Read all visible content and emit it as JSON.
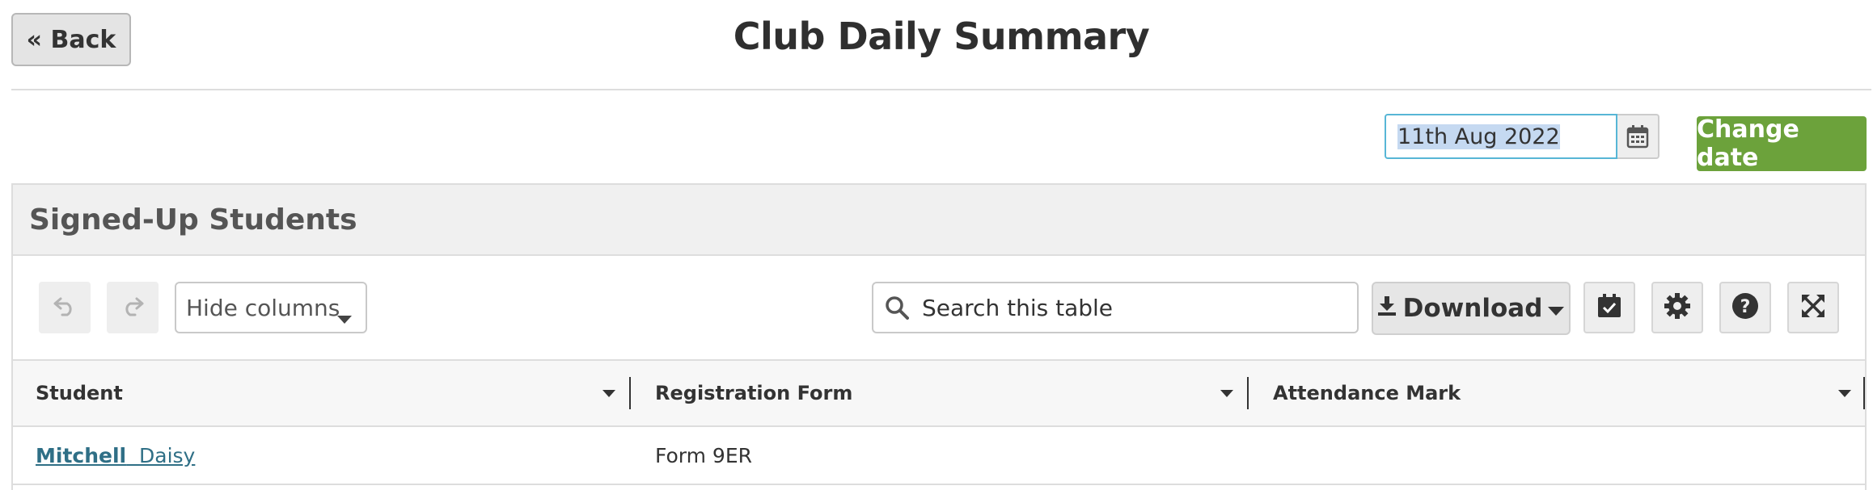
{
  "header": {
    "back_label": "« Back",
    "title": "Club Daily Summary"
  },
  "date_picker": {
    "value": "11th Aug 2022",
    "calendar_icon": "calendar-icon",
    "change_label": "Change date",
    "change_color": "#6ca23b"
  },
  "panel": {
    "title": "Signed-Up Students"
  },
  "toolbar": {
    "undo_icon": "undo-icon",
    "redo_icon": "redo-icon",
    "hide_columns_label": "Hide columns",
    "search_placeholder": "Search this table",
    "download_label": "Download",
    "select_icon": "calendar-check-icon",
    "settings_icon": "gear-icon",
    "help_icon": "question-circle-icon",
    "fullscreen_icon": "expand-icon"
  },
  "table": {
    "columns": [
      "Student",
      "Registration Form",
      "Attendance Mark"
    ],
    "rows": [
      {
        "surname": "Mitchell",
        "forename": "Daisy",
        "registration_form": "Form 9ER",
        "attendance_mark": ""
      }
    ]
  }
}
